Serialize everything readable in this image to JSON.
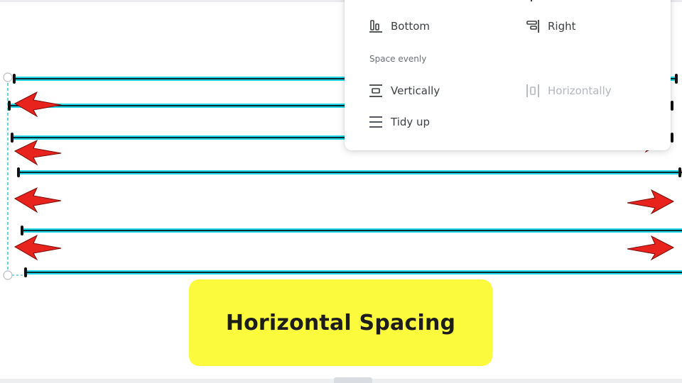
{
  "align_menu": {
    "items": {
      "bottom": "Bottom",
      "right": "Right",
      "vertically": "Vertically",
      "horizontally": "Horizontally",
      "tidy_up": "Tidy up"
    },
    "section_space_evenly": "Space evenly",
    "horizontally_disabled": true
  },
  "caption": {
    "text": "Horizontal Spacing",
    "background_color": "#fcfa3c"
  },
  "colors": {
    "line_glow": "#1ed8e8",
    "line_core": "#0b2a33",
    "arrow_fill": "#e8221c",
    "selection_dash": "#38c6d6"
  },
  "icons": {
    "bottom": "align-bottom-icon",
    "right": "align-right-icon",
    "vertically": "space-vertically-icon",
    "horizontally": "space-horizontally-icon",
    "tidy_up": "tidy-up-icon",
    "arrow": "red-arrow-icon"
  }
}
